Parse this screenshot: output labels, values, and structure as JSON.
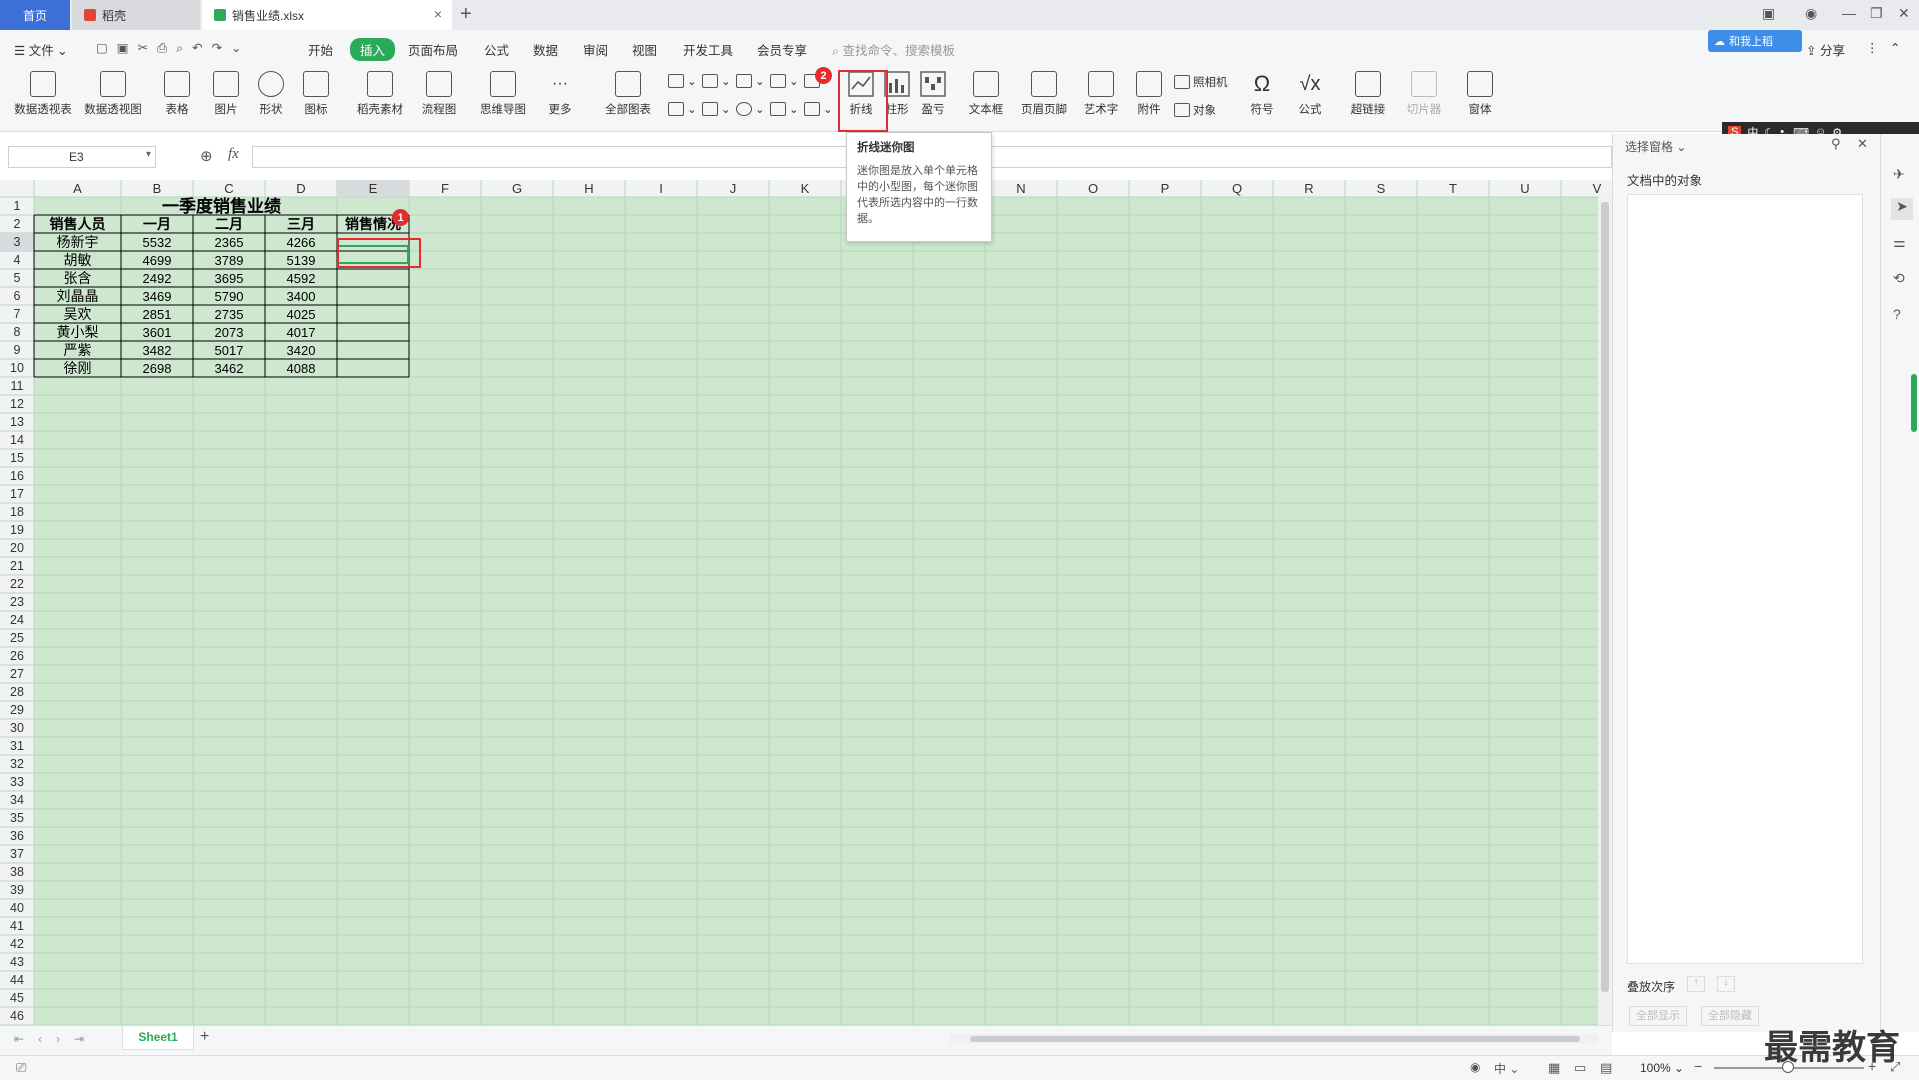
{
  "tabs": {
    "home": "首页",
    "wps": "稻壳",
    "file": "销售业绩.xlsx",
    "close": "×",
    "add": "+"
  },
  "menu": {
    "file": "文件",
    "items": [
      "开始",
      "插入",
      "页面布局",
      "公式",
      "数据",
      "审阅",
      "视图",
      "开发工具",
      "会员专享"
    ],
    "active": "插入",
    "search_placeholder": "查找命令、搜索模板",
    "share": "分享",
    "cloud_label": "和我上稻"
  },
  "ribbon": {
    "pivot_table": "数据透视表",
    "pivot_chart": "数据透视图",
    "table": "表格",
    "picture": "图片",
    "shape": "形状",
    "icon": "图标",
    "material": "稻壳素材",
    "flowchart": "流程图",
    "mindmap": "思维导图",
    "more": "更多",
    "all_charts": "全部图表",
    "sparkline_line": "折线",
    "sparkline_column": "柱形",
    "sparkline_winloss": "盈亏",
    "textbox": "文本框",
    "header_footer": "页眉页脚",
    "wordart": "艺术字",
    "attachment": "附件",
    "camera": "照相机",
    "object": "对象",
    "symbol": "符号",
    "formula": "公式",
    "hyperlink": "超链接",
    "slicer": "切片器",
    "window": "窗体"
  },
  "tooltip": {
    "title": "折线迷你图",
    "text": "迷你图是放入单个单元格中的小型图，每个迷你图代表所选内容中的一行数据。"
  },
  "formula_bar": {
    "name_box": "E3",
    "fx": "fx",
    "value": ""
  },
  "sheet": {
    "columns": [
      "A",
      "B",
      "C",
      "D",
      "E",
      "F",
      "G",
      "H",
      "I",
      "J",
      "K",
      "L",
      "M",
      "N",
      "O",
      "P",
      "Q",
      "R",
      "S",
      "T",
      "U",
      "V"
    ],
    "row_count": 46,
    "title": "一季度销售业绩",
    "headers": [
      "销售人员",
      "一月",
      "二月",
      "三月",
      "销售情况"
    ],
    "rows": [
      [
        "杨新宇",
        "5532",
        "2365",
        "4266"
      ],
      [
        "胡敏",
        "4699",
        "3789",
        "5139"
      ],
      [
        "张含",
        "2492",
        "3695",
        "4592"
      ],
      [
        "刘晶晶",
        "3469",
        "5790",
        "3400"
      ],
      [
        "吴欢",
        "2851",
        "2735",
        "4025"
      ],
      [
        "黄小梨",
        "3601",
        "2073",
        "4017"
      ],
      [
        "严紫",
        "3482",
        "5017",
        "3420"
      ],
      [
        "徐刚",
        "2698",
        "3462",
        "4088"
      ]
    ]
  },
  "badges": {
    "one": "1",
    "two": "2"
  },
  "panel": {
    "title": "选择窗格",
    "objects_label": "文档中的对象",
    "order_label": "叠放次序",
    "show_all": "全部显示",
    "hide_all": "全部隐藏"
  },
  "ime": "中",
  "sheet_tab": "Sheet1",
  "status": {
    "zoom": "100%",
    "input_mode": "中"
  },
  "watermark": "最需教育"
}
